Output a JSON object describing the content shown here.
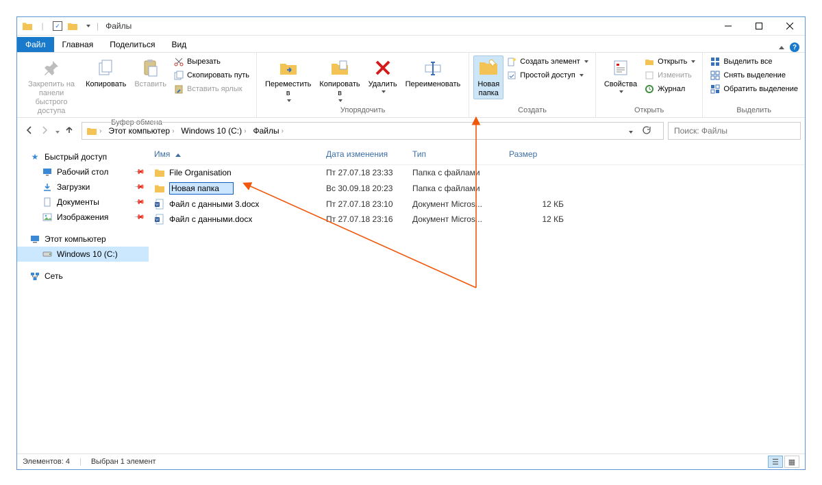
{
  "title": "Файлы",
  "tabs": {
    "file": "Файл",
    "home": "Главная",
    "share": "Поделиться",
    "view": "Вид"
  },
  "ribbon": {
    "clipboard": {
      "name": "Буфер обмена",
      "pin": "Закрепить на панели\nбыстрого доступа",
      "copy": "Копировать",
      "paste": "Вставить",
      "cut": "Вырезать",
      "copy_path": "Скопировать путь",
      "paste_shortcut": "Вставить ярлык"
    },
    "organize": {
      "name": "Упорядочить",
      "move_to": "Переместить\nв",
      "copy_to": "Копировать\nв",
      "delete": "Удалить",
      "rename": "Переименовать"
    },
    "create": {
      "name": "Создать",
      "new_folder": "Новая\nпапка",
      "new_item": "Создать элемент",
      "easy_access": "Простой доступ"
    },
    "open": {
      "name": "Открыть",
      "properties": "Свойства",
      "open_btn": "Открыть",
      "edit": "Изменить",
      "history": "Журнал"
    },
    "select": {
      "name": "Выделить",
      "select_all": "Выделить все",
      "select_none": "Снять выделение",
      "invert": "Обратить выделение"
    }
  },
  "breadcrumb": {
    "items": [
      "Этот компьютер",
      "Windows 10 (C:)",
      "Файлы"
    ]
  },
  "search": {
    "placeholder": "Поиск: Файлы"
  },
  "sidebar": {
    "quick_access": "Быстрый доступ",
    "desktop": "Рабочий стол",
    "downloads": "Загрузки",
    "documents": "Документы",
    "pictures": "Изображения",
    "this_pc": "Этот компьютер",
    "drive_c": "Windows 10 (C:)",
    "network": "Сеть"
  },
  "columns": {
    "name": "Имя",
    "date": "Дата изменения",
    "type": "Тип",
    "size": "Размер"
  },
  "files": [
    {
      "icon": "folder",
      "name": "File Organisation",
      "date": "Пт 27.07.18 23:33",
      "type": "Папка с файлами",
      "size": "",
      "editing": false
    },
    {
      "icon": "folder",
      "name": "Новая папка",
      "date": "Вс 30.09.18 20:23",
      "type": "Папка с файлами",
      "size": "",
      "editing": true
    },
    {
      "icon": "docx",
      "name": "Файл с данными 3.docx",
      "date": "Пт 27.07.18 23:10",
      "type": "Документ Micros...",
      "size": "12 КБ",
      "editing": false
    },
    {
      "icon": "docx",
      "name": "Файл с данными.docx",
      "date": "Пт 27.07.18 23:16",
      "type": "Документ Micros...",
      "size": "12 КБ",
      "editing": false
    }
  ],
  "statusbar": {
    "count": "Элементов: 4",
    "selected": "Выбран 1 элемент"
  },
  "colors": {
    "accent": "#1979ca",
    "highlight": "#cde6f7",
    "arrow": "#f0570a"
  }
}
